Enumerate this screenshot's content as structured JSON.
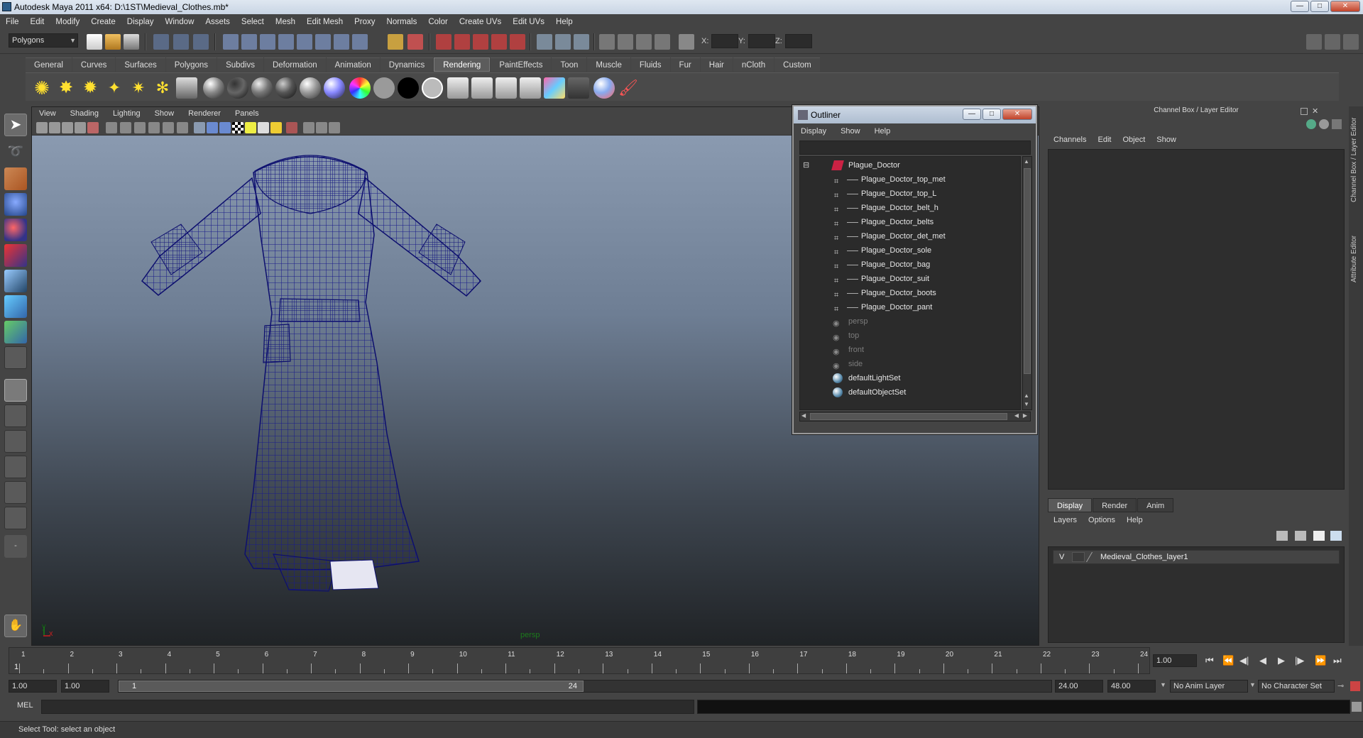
{
  "window": {
    "title": "Autodesk Maya 2011 x64: D:\\1ST\\Medieval_Clothes.mb*",
    "min": "—",
    "max": "□",
    "close": "✕"
  },
  "menubar": [
    "File",
    "Edit",
    "Modify",
    "Create",
    "Display",
    "Window",
    "Assets",
    "Select",
    "Mesh",
    "Edit Mesh",
    "Proxy",
    "Normals",
    "Color",
    "Create UVs",
    "Edit UVs",
    "Help"
  ],
  "status": {
    "mode": "Polygons",
    "x_label": "X:",
    "y_label": "Y:",
    "z_label": "Z:"
  },
  "shelf_tabs": [
    "General",
    "Curves",
    "Surfaces",
    "Polygons",
    "Subdivs",
    "Deformation",
    "Animation",
    "Dynamics",
    "Rendering",
    "PaintEffects",
    "Toon",
    "Muscle",
    "Fluids",
    "Fur",
    "Hair",
    "nCloth",
    "Custom"
  ],
  "active_shelf_tab": "Rendering",
  "viewport": {
    "menu": [
      "View",
      "Shading",
      "Lighting",
      "Show",
      "Renderer",
      "Panels"
    ],
    "camera_label": "persp",
    "axis_y": "y",
    "axis_x": "x"
  },
  "outliner": {
    "title": "Outliner",
    "menu": [
      "Display",
      "Show",
      "Help"
    ],
    "root": "Plague_Doctor",
    "children": [
      "Plague_Doctor_top_met",
      "Plague_Doctor_top_L",
      "Plague_Doctor_belt_h",
      "Plague_Doctor_belts",
      "Plague_Doctor_det_met",
      "Plague_Doctor_sole",
      "Plague_Doctor_bag",
      "Plague_Doctor_suit",
      "Plague_Doctor_boots",
      "Plague_Doctor_pant"
    ],
    "cameras": [
      "persp",
      "top",
      "front",
      "side"
    ],
    "sets": [
      "defaultLightSet",
      "defaultObjectSet"
    ]
  },
  "channel_box": {
    "title": "Channel Box / Layer Editor",
    "menu": [
      "Channels",
      "Edit",
      "Object",
      "Show"
    ],
    "side_tabs": [
      "Channel Box / Layer Editor",
      "Attribute Editor"
    ]
  },
  "layer_editor": {
    "tabs": [
      "Display",
      "Render",
      "Anim"
    ],
    "active_tab": "Display",
    "menu": [
      "Layers",
      "Options",
      "Help"
    ],
    "layers": [
      {
        "visible": "V",
        "name": "Medieval_Clothes_layer1"
      }
    ]
  },
  "timeline": {
    "frames": [
      "1",
      "2",
      "3",
      "4",
      "5",
      "6",
      "7",
      "8",
      "9",
      "10",
      "11",
      "12",
      "13",
      "14",
      "15",
      "16",
      "17",
      "18",
      "19",
      "20",
      "21",
      "22",
      "23",
      "24"
    ],
    "current_frame": "1",
    "current_time": "1.00",
    "playback": [
      "⏮",
      "⏪",
      "◀|",
      "◀",
      "▶",
      "|▶",
      "⏩",
      "⏭"
    ]
  },
  "range": {
    "start_time": "1.00",
    "start_playback": "1.00",
    "handle_start": "1",
    "handle_end": "24",
    "end_playback": "24.00",
    "end_time": "48.00",
    "anim_layer": "No Anim Layer",
    "char_set": "No Character Set"
  },
  "command": {
    "label": "MEL"
  },
  "help_line": "Select Tool: select an object"
}
